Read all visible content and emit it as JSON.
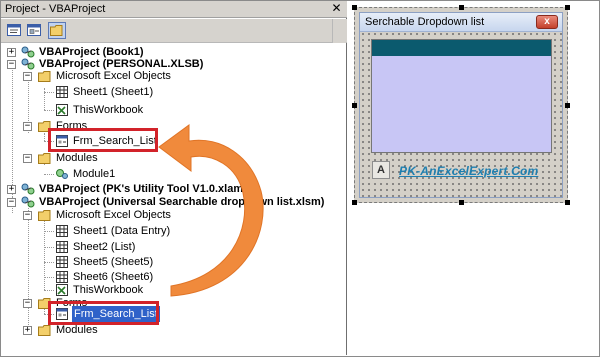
{
  "project_explorer": {
    "title": "Project - VBAProject",
    "close_glyph": "✕",
    "toolbar": {
      "buttons": [
        "view-code-icon",
        "view-object-icon",
        "toggle-folders-icon"
      ]
    },
    "tree": {
      "book1": "VBAProject (Book1)",
      "personal": "VBAProject (PERSONAL.XLSB)",
      "personal_excel_objects": "Microsoft Excel Objects",
      "personal_sheet1": "Sheet1 (Sheet1)",
      "personal_thisworkbook": "ThisWorkbook",
      "personal_forms": "Forms",
      "personal_form": "Frm_Search_List",
      "personal_modules": "Modules",
      "personal_module1": "Module1",
      "utility": "VBAProject (PK's Utility Tool V1.0.xlam)",
      "universal": "VBAProject (Universal Searchable dropdown list.xlsm)",
      "universal_excel_objects": "Microsoft Excel Objects",
      "universal_sheet1": "Sheet1 (Data Entry)",
      "universal_sheet2": "Sheet2 (List)",
      "universal_sheet5": "Sheet5 (Sheet5)",
      "universal_sheet6": "Sheet6 (Sheet6)",
      "universal_thisworkbook": "ThisWorkbook",
      "universal_forms": "Forms",
      "universal_form": "Frm_Search_List",
      "universal_modules": "Modules"
    },
    "expander_minus": "−",
    "expander_plus": "+"
  },
  "designer": {
    "form_title": "Serchable Dropdown list",
    "close_glyph": "x",
    "logo_glyph": "A",
    "link_text": "PK-AnExcelExpert.Com"
  },
  "colors": {
    "highlight_box": "#d2232a",
    "arrow": "#f08a3c",
    "selection": "#2f62c9",
    "list_header": "#0b5a6e",
    "list_body": "#c8c6f5"
  }
}
